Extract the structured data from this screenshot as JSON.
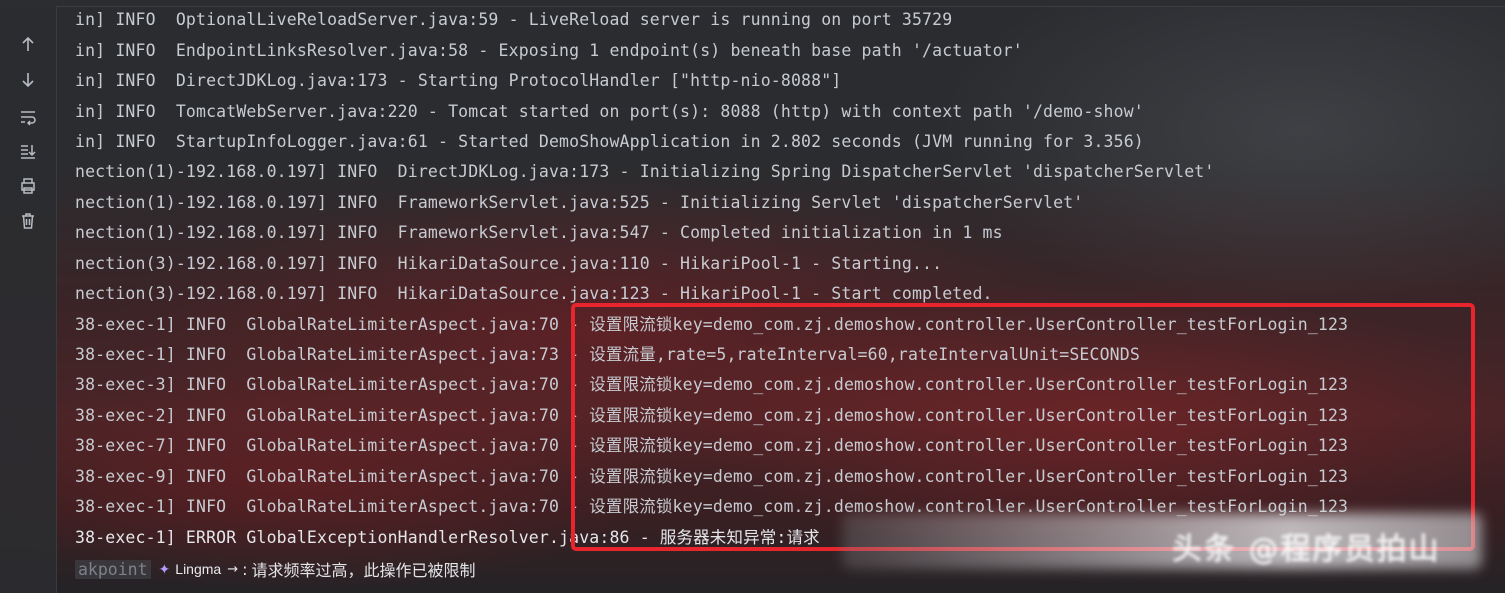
{
  "log_lines": [
    "in] INFO  OptionalLiveReloadServer.java:59 - LiveReload server is running on port 35729",
    "in] INFO  EndpointLinksResolver.java:58 - Exposing 1 endpoint(s) beneath base path '/actuator'",
    "in] INFO  DirectJDKLog.java:173 - Starting ProtocolHandler [\"http-nio-8088\"]",
    "in] INFO  TomcatWebServer.java:220 - Tomcat started on port(s): 8088 (http) with context path '/demo-show'",
    "in] INFO  StartupInfoLogger.java:61 - Started DemoShowApplication in 2.802 seconds (JVM running for 3.356)",
    "nection(1)-192.168.0.197] INFO  DirectJDKLog.java:173 - Initializing Spring DispatcherServlet 'dispatcherServlet'",
    "nection(1)-192.168.0.197] INFO  FrameworkServlet.java:525 - Initializing Servlet 'dispatcherServlet'",
    "nection(1)-192.168.0.197] INFO  FrameworkServlet.java:547 - Completed initialization in 1 ms",
    "nection(3)-192.168.0.197] INFO  HikariDataSource.java:110 - HikariPool-1 - Starting...",
    "nection(3)-192.168.0.197] INFO  HikariDataSource.java:123 - HikariPool-1 - Start completed.",
    "38-exec-1] INFO  GlobalRateLimiterAspect.java:70 - 设置限流锁key=demo_com.zj.demoshow.controller.UserController_testForLogin_123",
    "38-exec-1] INFO  GlobalRateLimiterAspect.java:73 - 设置流量,rate=5,rateInterval=60,rateIntervalUnit=SECONDS",
    "38-exec-3] INFO  GlobalRateLimiterAspect.java:70 - 设置限流锁key=demo_com.zj.demoshow.controller.UserController_testForLogin_123",
    "38-exec-2] INFO  GlobalRateLimiterAspect.java:70 - 设置限流锁key=demo_com.zj.demoshow.controller.UserController_testForLogin_123",
    "38-exec-7] INFO  GlobalRateLimiterAspect.java:70 - 设置限流锁key=demo_com.zj.demoshow.controller.UserController_testForLogin_123",
    "38-exec-9] INFO  GlobalRateLimiterAspect.java:70 - 设置限流锁key=demo_com.zj.demoshow.controller.UserController_testForLogin_123",
    "38-exec-1] INFO  GlobalRateLimiterAspect.java:70 - 设置限流锁key=demo_com.zj.demoshow.controller.UserController_testForLogin_123",
    "38-exec-1] ERROR GlobalExceptionHandlerResolver.java:86 - 服务器未知异常:请求"
  ],
  "status": {
    "breakpoint_tag": "akpoint",
    "assistant_name": "Lingma",
    "assistant_arrow": "→",
    "separator": ":",
    "message": "请求频率过高，此操作已被限制"
  },
  "toolbar": {
    "scroll_up_icon": "arrow-up-icon",
    "scroll_down_icon": "arrow-down-icon",
    "soft_wrap_icon": "soft-wrap-icon",
    "scroll_to_end_icon": "scroll-to-end-icon",
    "print_icon": "print-icon",
    "clear_icon": "trash-icon"
  },
  "watermark": "头条 @程序员拍山",
  "colors": {
    "highlight_border": "#e8252c",
    "log_text": "#c7cbd1",
    "assistant_accent": "#b49cff"
  }
}
